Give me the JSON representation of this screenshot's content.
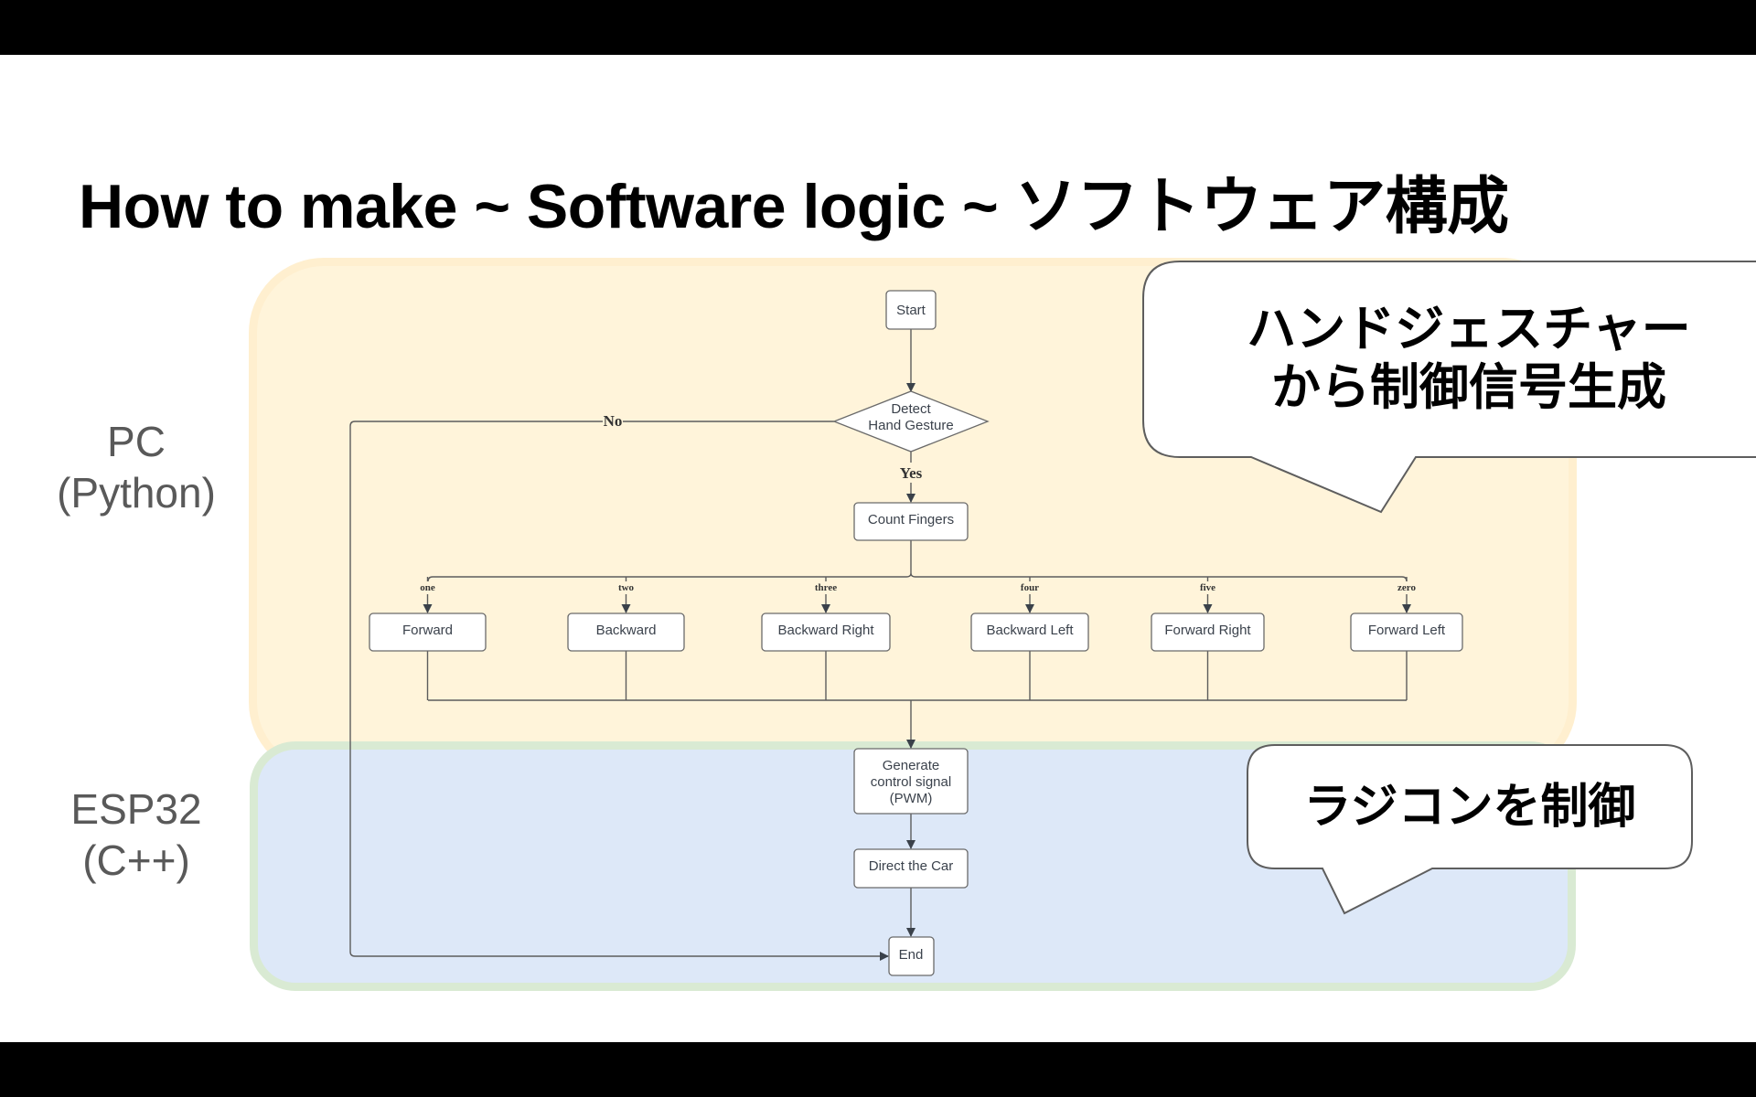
{
  "slide": {
    "title": "How to make ~ Software logic ~ ソフトウェア構成"
  },
  "zones": [
    {
      "id": "pc",
      "label_line1": "PC",
      "label_line2": "(Python)",
      "fill": "#fff4da",
      "border": "#ffefcf"
    },
    {
      "id": "esp32",
      "label_line1": "ESP32",
      "label_line2": "(C++)",
      "fill": "#dde8f8",
      "border": "#d9ead3"
    }
  ],
  "flowchart": {
    "start": "Start",
    "decision_line1": "Detect",
    "decision_line2": "Hand Gesture",
    "yes_label": "Yes",
    "no_label": "No",
    "count": "Count Fingers",
    "branches": [
      {
        "label": "one",
        "action": "Forward"
      },
      {
        "label": "two",
        "action": "Backward"
      },
      {
        "label": "three",
        "action": "Backward Right"
      },
      {
        "label": "four",
        "action": "Backward Left"
      },
      {
        "label": "five",
        "action": "Forward Right"
      },
      {
        "label": "zero",
        "action": "Forward Left"
      }
    ],
    "generate_line1": "Generate",
    "generate_line2": "control signal",
    "generate_line3": "(PWM)",
    "direct": "Direct the Car",
    "end": "End"
  },
  "callouts": {
    "top_line1": "ハンドジェスチャー",
    "top_line2": "から制御信号生成",
    "bottom": "ラジコンを制御"
  },
  "colors": {
    "line": "#5c5c5c",
    "node_border": "#6a6a6a",
    "node_text": "#3b424c"
  }
}
